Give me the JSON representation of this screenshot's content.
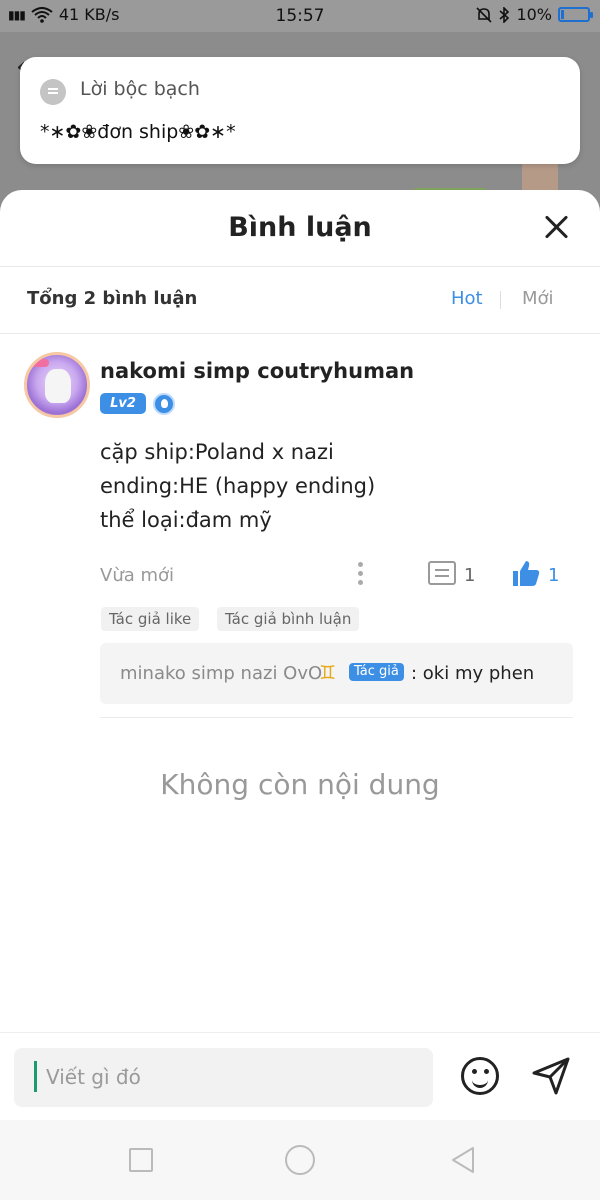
{
  "status_bar": {
    "signal": "‡il",
    "network_speed": "41 KB/s",
    "time": "15:57",
    "battery_percent": "10%",
    "battery_level": 0.1
  },
  "notification": {
    "app_name": "Lời bộc bạch",
    "message": "*∗✿❀đơn ship❀✿∗*"
  },
  "comments_sheet": {
    "title": "Bình luận",
    "total_label": "Tổng 2 bình luận",
    "sort_hot": "Hot",
    "sort_new": "Mới",
    "comment": {
      "username": "nakomi simp coutryhuman",
      "level_badge": "Lv2",
      "lines": [
        "cặp ship:Poland x nazi",
        "ending:HE (happy ending)",
        "thể loại:đam mỹ"
      ],
      "time": "Vừa mới",
      "reply_count": "1",
      "like_count": "1",
      "tags": [
        "Tác giả like",
        "Tác giả bình luận"
      ],
      "reply": {
        "name": "minako simp nazi OvO",
        "zodiac": "♊",
        "author_badge": "Tác giả",
        "text": ": oki my phen"
      }
    },
    "no_more": "Không còn nội dung"
  },
  "input_bar": {
    "placeholder": "Viết gì đó"
  },
  "colors": {
    "accent": "#3d8fe6",
    "zodiac": "#e6a817"
  }
}
